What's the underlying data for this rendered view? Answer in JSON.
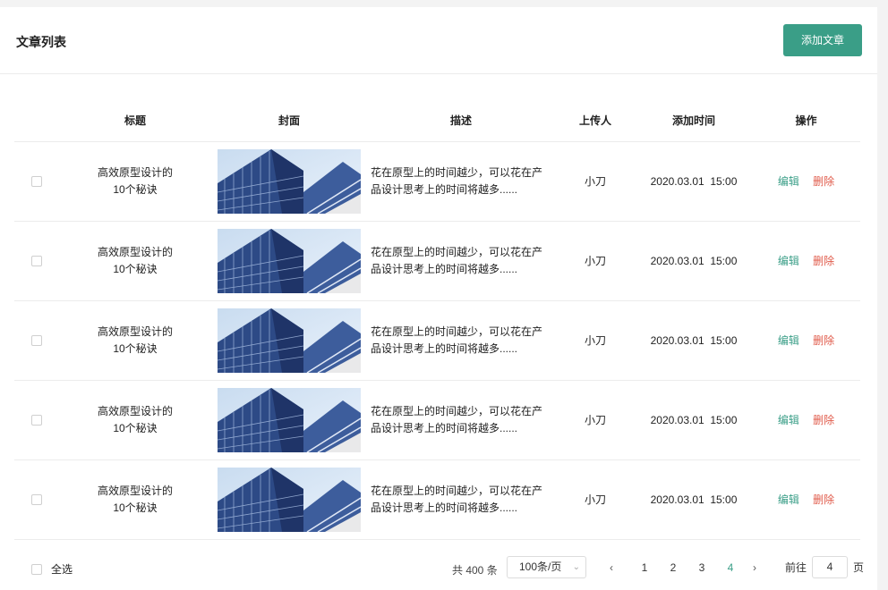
{
  "header": {
    "title": "文章列表",
    "add_button": "添加文章"
  },
  "table": {
    "columns": [
      "",
      "标题",
      "封面",
      "描述",
      "上传人",
      "添加时间",
      "操作"
    ],
    "rows": [
      {
        "title_line1": "高效原型设计的",
        "title_line2": "10个秘诀",
        "desc_line1": "花在原型上的时间越少，可以花在产",
        "desc_line2": "品设计思考上的时间将越多......",
        "uploader": "小刀",
        "time": "2020.03.01  15:00",
        "edit": "编辑",
        "delete": "删除"
      },
      {
        "title_line1": "高效原型设计的",
        "title_line2": "10个秘诀",
        "desc_line1": "花在原型上的时间越少，可以花在产",
        "desc_line2": "品设计思考上的时间将越多......",
        "uploader": "小刀",
        "time": "2020.03.01  15:00",
        "edit": "编辑",
        "delete": "删除"
      },
      {
        "title_line1": "高效原型设计的",
        "title_line2": "10个秘诀",
        "desc_line1": "花在原型上的时间越少，可以花在产",
        "desc_line2": "品设计思考上的时间将越多......",
        "uploader": "小刀",
        "time": "2020.03.01  15:00",
        "edit": "编辑",
        "delete": "删除"
      },
      {
        "title_line1": "高效原型设计的",
        "title_line2": "10个秘诀",
        "desc_line1": "花在原型上的时间越少，可以花在产",
        "desc_line2": "品设计思考上的时间将越多......",
        "uploader": "小刀",
        "time": "2020.03.01  15:00",
        "edit": "编辑",
        "delete": "删除"
      },
      {
        "title_line1": "高效原型设计的",
        "title_line2": "10个秘诀",
        "desc_line1": "花在原型上的时间越少，可以花在产",
        "desc_line2": "品设计思考上的时间将越多......",
        "uploader": "小刀",
        "time": "2020.03.01  15:00",
        "edit": "编辑",
        "delete": "删除"
      }
    ]
  },
  "footer": {
    "select_all": "全选",
    "total": "共 400 条",
    "page_size": "100条/页",
    "pages": [
      "1",
      "2",
      "3",
      "4"
    ],
    "current_page": "4",
    "goto_label": "前往",
    "goto_value": "4",
    "goto_unit": "页",
    "prev_icon": "chevron-left-icon",
    "next_icon": "chevron-right-icon"
  },
  "colors": {
    "accent": "#3a9e87",
    "danger": "#e05a4a"
  }
}
